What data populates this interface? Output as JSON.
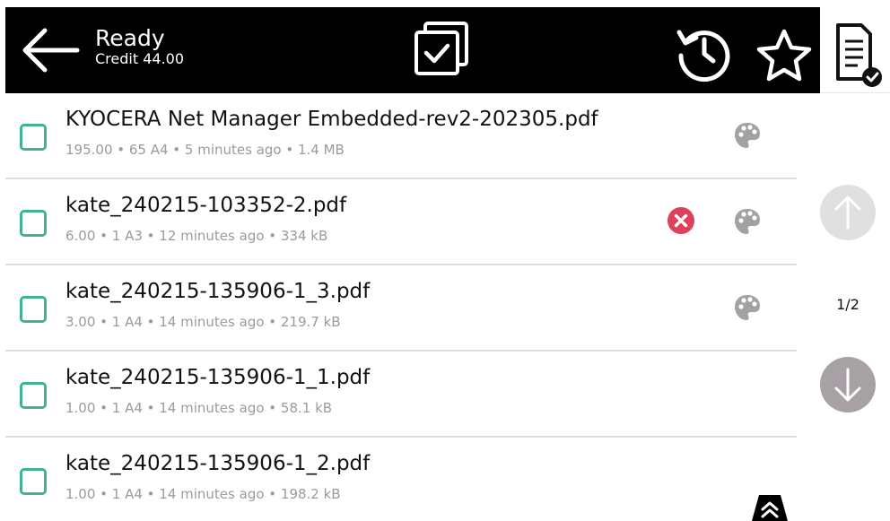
{
  "header": {
    "status_title": "Ready",
    "credit_label": "Credit 44.00"
  },
  "pagination": {
    "indicator": "1/2"
  },
  "colors": {
    "header_bg": "#000000",
    "accent_checkbox": "#3fb394",
    "error": "#e0415a",
    "palette": "#a3a1a2",
    "page_down": "#a7a1a5",
    "page_up_disabled": "#e0e0e0"
  },
  "jobs": [
    {
      "name": "KYOCERA Net Manager Embedded-rev2-202305.pdf",
      "meta": "195.00 • 65 A4 • 5 minutes ago • 1.4 MB",
      "has_error": false,
      "color": true
    },
    {
      "name": "kate_240215-103352-2.pdf",
      "meta": "6.00 • 1 A3 • 12 minutes ago • 334 kB",
      "has_error": true,
      "color": true
    },
    {
      "name": "kate_240215-135906-1_3.pdf",
      "meta": "3.00 • 1 A4 • 14 minutes ago • 219.7 kB",
      "has_error": false,
      "color": true
    },
    {
      "name": "kate_240215-135906-1_1.pdf",
      "meta": "1.00 • 1 A4 • 14 minutes ago • 58.1 kB",
      "has_error": false,
      "color": false
    },
    {
      "name": "kate_240215-135906-1_2.pdf",
      "meta": "1.00 • 1 A4 • 14 minutes ago • 198.2 kB",
      "has_error": false,
      "color": false
    }
  ],
  "icons": {
    "back": "arrow-left-icon",
    "select_all": "select-all-icon",
    "history": "history-icon",
    "favorite": "star-icon",
    "documents": "document-check-icon",
    "error": "error-x-icon",
    "palette": "palette-icon",
    "page_up": "arrow-up-icon",
    "page_down": "arrow-down-icon",
    "collapse": "double-chevron-up-icon"
  }
}
